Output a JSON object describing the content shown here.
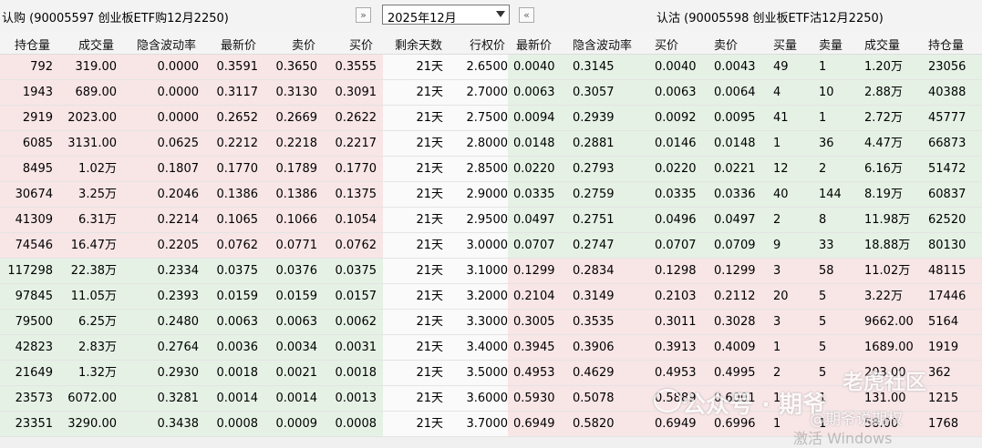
{
  "toolbar": {
    "call_title": "认购 (90005597  创业板ETF购12月2250)",
    "put_title": "认沽 (90005598  创业板ETF沽12月2250)",
    "month": "2025年12月",
    "prev_btn": "»",
    "next_btn": "«"
  },
  "colors": {
    "call_itm_bg": "#f8e5e6",
    "call_otm_bg": "#e5f1e5",
    "put_itm_bg": "#f8e5e6",
    "put_otm_bg": "#e5f1e5",
    "mid_bg": "#fafafa"
  },
  "columns": {
    "call": [
      "持仓量",
      "成交量",
      "隐含波动率",
      "最新价",
      "卖价",
      "买价"
    ],
    "mid": [
      "剩余天数",
      "行权价"
    ],
    "put": [
      "最新价",
      "隐含波动率",
      "买价",
      "卖价",
      "买量",
      "卖量",
      "成交量",
      "持仓量"
    ]
  },
  "rows": [
    {
      "call": [
        "792",
        "319.00",
        "0.0000",
        "0.3591",
        "0.3650",
        "0.3555"
      ],
      "days": "21天",
      "strike": "2.6500",
      "put": [
        "0.0040",
        "0.3145",
        "0.0040",
        "0.0043",
        "49",
        "1",
        "1.20万",
        "23056"
      ]
    },
    {
      "call": [
        "1943",
        "689.00",
        "0.0000",
        "0.3117",
        "0.3130",
        "0.3091"
      ],
      "days": "21天",
      "strike": "2.7000",
      "put": [
        "0.0063",
        "0.3057",
        "0.0063",
        "0.0064",
        "4",
        "10",
        "2.88万",
        "40388"
      ]
    },
    {
      "call": [
        "2919",
        "2023.00",
        "0.0000",
        "0.2652",
        "0.2669",
        "0.2622"
      ],
      "days": "21天",
      "strike": "2.7500",
      "put": [
        "0.0094",
        "0.2939",
        "0.0092",
        "0.0095",
        "41",
        "1",
        "2.72万",
        "45777"
      ]
    },
    {
      "call": [
        "6085",
        "3131.00",
        "0.0625",
        "0.2212",
        "0.2218",
        "0.2217"
      ],
      "days": "21天",
      "strike": "2.8000",
      "put": [
        "0.0148",
        "0.2881",
        "0.0146",
        "0.0148",
        "1",
        "36",
        "4.47万",
        "66873"
      ]
    },
    {
      "call": [
        "8495",
        "1.02万",
        "0.1807",
        "0.1770",
        "0.1789",
        "0.1770"
      ],
      "days": "21天",
      "strike": "2.8500",
      "put": [
        "0.0220",
        "0.2793",
        "0.0220",
        "0.0221",
        "12",
        "2",
        "6.16万",
        "51472"
      ]
    },
    {
      "call": [
        "30674",
        "3.25万",
        "0.2046",
        "0.1386",
        "0.1386",
        "0.1375"
      ],
      "days": "21天",
      "strike": "2.9000",
      "put": [
        "0.0335",
        "0.2759",
        "0.0335",
        "0.0336",
        "40",
        "144",
        "8.19万",
        "60837"
      ]
    },
    {
      "call": [
        "41309",
        "6.31万",
        "0.2214",
        "0.1065",
        "0.1066",
        "0.1054"
      ],
      "days": "21天",
      "strike": "2.9500",
      "put": [
        "0.0497",
        "0.2751",
        "0.0496",
        "0.0497",
        "2",
        "8",
        "11.98万",
        "62520"
      ]
    },
    {
      "call": [
        "74546",
        "16.47万",
        "0.2205",
        "0.0762",
        "0.0771",
        "0.0762"
      ],
      "days": "21天",
      "strike": "3.0000",
      "put": [
        "0.0707",
        "0.2747",
        "0.0707",
        "0.0709",
        "9",
        "33",
        "18.88万",
        "80130"
      ]
    },
    {
      "call": [
        "117298",
        "22.38万",
        "0.2334",
        "0.0375",
        "0.0376",
        "0.0375"
      ],
      "days": "21天",
      "strike": "3.1000",
      "put": [
        "0.1299",
        "0.2834",
        "0.1298",
        "0.1299",
        "3",
        "58",
        "11.02万",
        "48115"
      ]
    },
    {
      "call": [
        "97845",
        "11.05万",
        "0.2393",
        "0.0159",
        "0.0159",
        "0.0157"
      ],
      "days": "21天",
      "strike": "3.2000",
      "put": [
        "0.2104",
        "0.3149",
        "0.2103",
        "0.2112",
        "20",
        "5",
        "3.22万",
        "17446"
      ]
    },
    {
      "call": [
        "79500",
        "6.25万",
        "0.2480",
        "0.0063",
        "0.0063",
        "0.0062"
      ],
      "days": "21天",
      "strike": "3.3000",
      "put": [
        "0.3005",
        "0.3535",
        "0.3011",
        "0.3028",
        "3",
        "5",
        "9662.00",
        "5164"
      ]
    },
    {
      "call": [
        "42823",
        "2.83万",
        "0.2764",
        "0.0036",
        "0.0034",
        "0.0031"
      ],
      "days": "21天",
      "strike": "3.4000",
      "put": [
        "0.3945",
        "0.3906",
        "0.3913",
        "0.4009",
        "1",
        "5",
        "1689.00",
        "1919"
      ]
    },
    {
      "call": [
        "21649",
        "1.32万",
        "0.2930",
        "0.0018",
        "0.0021",
        "0.0018"
      ],
      "days": "21天",
      "strike": "3.5000",
      "put": [
        "0.4953",
        "0.4629",
        "0.4953",
        "0.4995",
        "2",
        "5",
        "203.00",
        "362"
      ]
    },
    {
      "call": [
        "23573",
        "6072.00",
        "0.3281",
        "0.0014",
        "0.0014",
        "0.0013"
      ],
      "days": "21天",
      "strike": "3.6000",
      "put": [
        "0.5930",
        "0.5078",
        "0.5889",
        "0.6001",
        "1",
        "1",
        "131.00",
        "1215"
      ]
    },
    {
      "call": [
        "23351",
        "3290.00",
        "0.3438",
        "0.0008",
        "0.0009",
        "0.0008"
      ],
      "days": "21天",
      "strike": "3.7000",
      "put": [
        "0.6949",
        "0.5820",
        "0.6949",
        "0.6996",
        "1",
        "1",
        "58.00",
        "1768"
      ]
    }
  ],
  "watermarks": {
    "account": "公众号 · 期爷",
    "community": "老虎社区",
    "author": "@期爷说期权",
    "windows": "激活 Windows"
  }
}
